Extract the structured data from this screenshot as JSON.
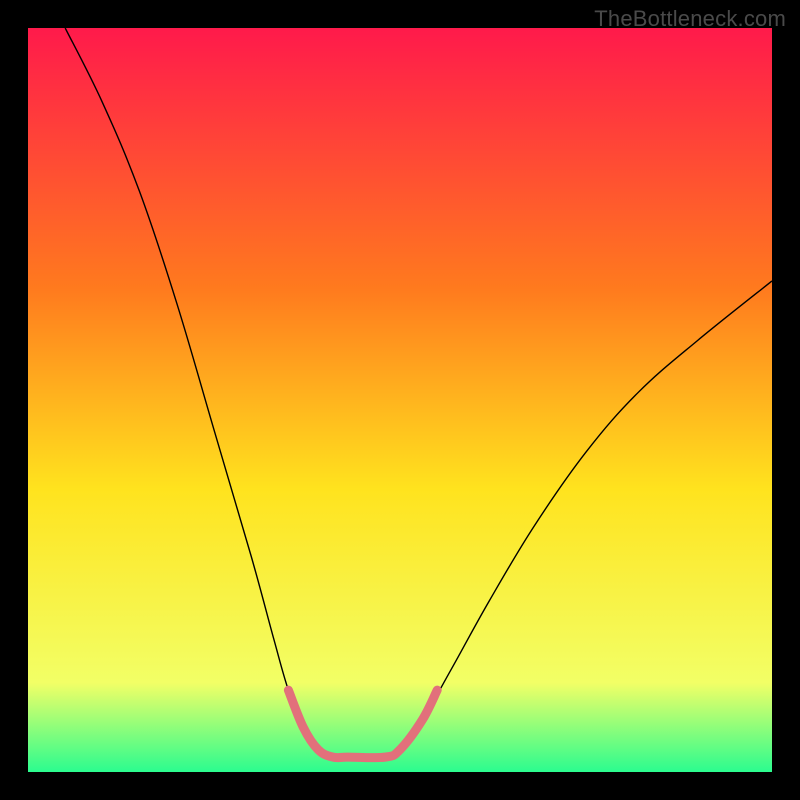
{
  "watermark": "TheBottleneck.com",
  "chart_data": {
    "type": "line",
    "title": "",
    "xlabel": "",
    "ylabel": "",
    "xlim": [
      0,
      100
    ],
    "ylim": [
      0,
      100
    ],
    "background_gradient": {
      "top": "#ff1a4b",
      "mid1": "#ff7a1e",
      "mid2": "#ffe31e",
      "mid3": "#f2ff66",
      "bottom": "#2bfc8f"
    },
    "series": [
      {
        "name": "left-curve",
        "stroke": "#000000",
        "stroke_width": 1.4,
        "points": [
          {
            "x": 5,
            "y": 100
          },
          {
            "x": 10,
            "y": 90
          },
          {
            "x": 15,
            "y": 78
          },
          {
            "x": 20,
            "y": 63
          },
          {
            "x": 25,
            "y": 46
          },
          {
            "x": 30,
            "y": 29
          },
          {
            "x": 33,
            "y": 18
          },
          {
            "x": 35,
            "y": 11
          },
          {
            "x": 37,
            "y": 6
          },
          {
            "x": 39,
            "y": 3
          },
          {
            "x": 41,
            "y": 2
          },
          {
            "x": 43,
            "y": 2
          }
        ]
      },
      {
        "name": "right-curve",
        "stroke": "#000000",
        "stroke_width": 1.4,
        "points": [
          {
            "x": 48,
            "y": 2
          },
          {
            "x": 50,
            "y": 3
          },
          {
            "x": 53,
            "y": 7
          },
          {
            "x": 57,
            "y": 14
          },
          {
            "x": 62,
            "y": 23
          },
          {
            "x": 68,
            "y": 33
          },
          {
            "x": 75,
            "y": 43
          },
          {
            "x": 82,
            "y": 51
          },
          {
            "x": 90,
            "y": 58
          },
          {
            "x": 100,
            "y": 66
          }
        ]
      },
      {
        "name": "pink-marker-band",
        "stroke": "#e2707b",
        "stroke_width": 9,
        "linecap": "round",
        "points": [
          {
            "x": 35,
            "y": 11
          },
          {
            "x": 37,
            "y": 6
          },
          {
            "x": 39,
            "y": 3
          },
          {
            "x": 41,
            "y": 2
          },
          {
            "x": 43,
            "y": 2
          },
          {
            "x": 48,
            "y": 2
          },
          {
            "x": 50,
            "y": 3
          },
          {
            "x": 53,
            "y": 7
          },
          {
            "x": 55,
            "y": 11
          }
        ]
      }
    ]
  }
}
